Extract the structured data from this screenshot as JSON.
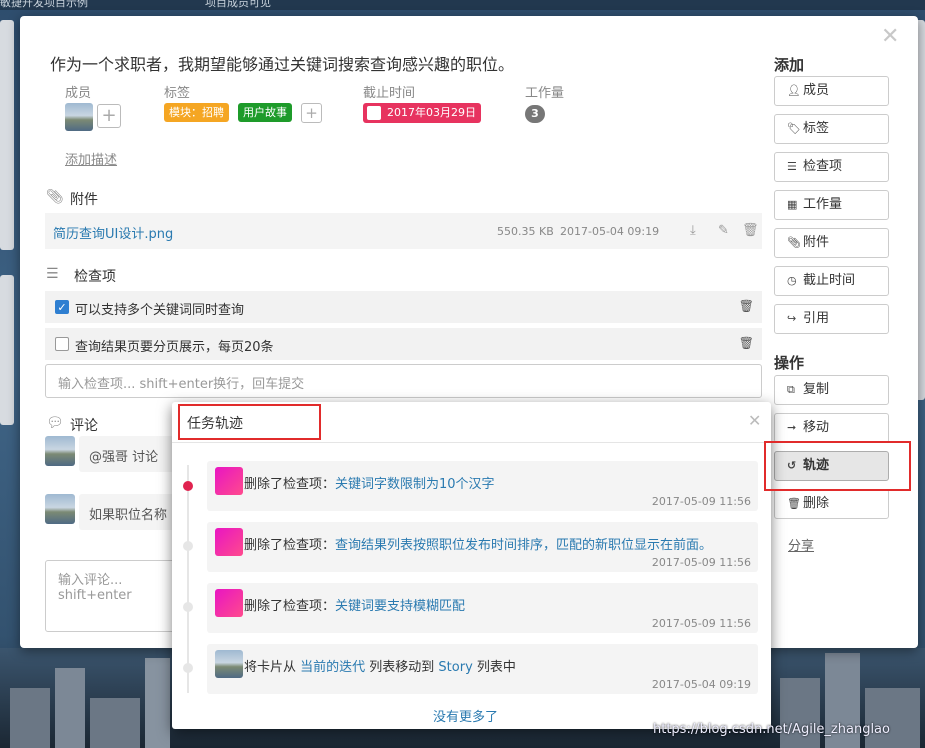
{
  "topbar": {
    "left": "敏捷开发项目示例",
    "right": "项目成员可见"
  },
  "card": {
    "title": "作为一个求职者，我期望能够通过关键词搜索查询感兴趣的职位。",
    "members_label": "成员",
    "tags_label": "标签",
    "due_label": "截止时间",
    "workload_label": "工作量",
    "tags": [
      {
        "text": "模块：招聘",
        "color": "#f5a623"
      },
      {
        "text": "用户故事",
        "color": "#1e9b2a"
      }
    ],
    "due_date": "2017年03月29日",
    "due_color": "#e7335f",
    "workload": "3",
    "add_description": "添加描述"
  },
  "attachments": {
    "heading": "附件",
    "items": [
      {
        "name": "简历查询UI设计.png",
        "size": "550.35 KB",
        "date": "2017-05-04 09:19"
      }
    ]
  },
  "checklist": {
    "heading": "检查项",
    "items": [
      {
        "text": "可以支持多个关键词同时查询",
        "checked": true
      },
      {
        "text": "查询结果页要分页展示，每页20条",
        "checked": false
      }
    ],
    "input_placeholder": "输入检查项... shift+enter换行，回车提交"
  },
  "comments": {
    "heading": "评论",
    "items": [
      {
        "text": "@强哥 讨论"
      },
      {
        "text": "如果职位名称"
      }
    ],
    "input_placeholder": "输入评论... shift+enter"
  },
  "sidebar": {
    "add_heading": "添加",
    "add_buttons": [
      {
        "label": "成员",
        "icon": "user-plus-icon"
      },
      {
        "label": "标签",
        "icon": "tag-icon"
      },
      {
        "label": "检查项",
        "icon": "list-icon"
      },
      {
        "label": "工作量",
        "icon": "grid-icon"
      },
      {
        "label": "附件",
        "icon": "paperclip-icon"
      },
      {
        "label": "截止时间",
        "icon": "clock-icon"
      },
      {
        "label": "引用",
        "icon": "share-arrow-icon"
      }
    ],
    "ops_heading": "操作",
    "op_buttons": [
      {
        "label": "复制",
        "icon": "copy-icon"
      },
      {
        "label": "移动",
        "icon": "arrow-right-icon"
      },
      {
        "label": "轨迹",
        "icon": "history-icon"
      },
      {
        "label": "删除",
        "icon": "trash-icon"
      }
    ],
    "share_label": "分享"
  },
  "track_popup": {
    "title": "任务轨迹",
    "events": [
      {
        "prefix": "删除了检查项：",
        "link": "关键词字数限制为10个汉字",
        "suffix": "",
        "time": "2017-05-09 11:56"
      },
      {
        "prefix": "删除了检查项：",
        "link": "查询结果列表按照职位发布时间排序，匹配的新职位显示在前面。",
        "suffix": "",
        "time": "2017-05-09 11:56"
      },
      {
        "prefix": "删除了检查项：",
        "link": "关键词要支持模糊匹配",
        "suffix": "",
        "time": "2017-05-09 11:56"
      },
      {
        "prefix": "将卡片从 ",
        "link": "当前的迭代",
        "mid": " 列表移动到 ",
        "link2": "Story",
        "suffix": " 列表中",
        "time": "2017-05-04 09:19"
      }
    ],
    "no_more": "没有更多了"
  },
  "watermark": "https://blog.csdn.net/Agile_zhanglao",
  "colors": {
    "highlight": "#e12b2b",
    "link": "#2a7ab0",
    "timeline_active": "#e0234f"
  }
}
